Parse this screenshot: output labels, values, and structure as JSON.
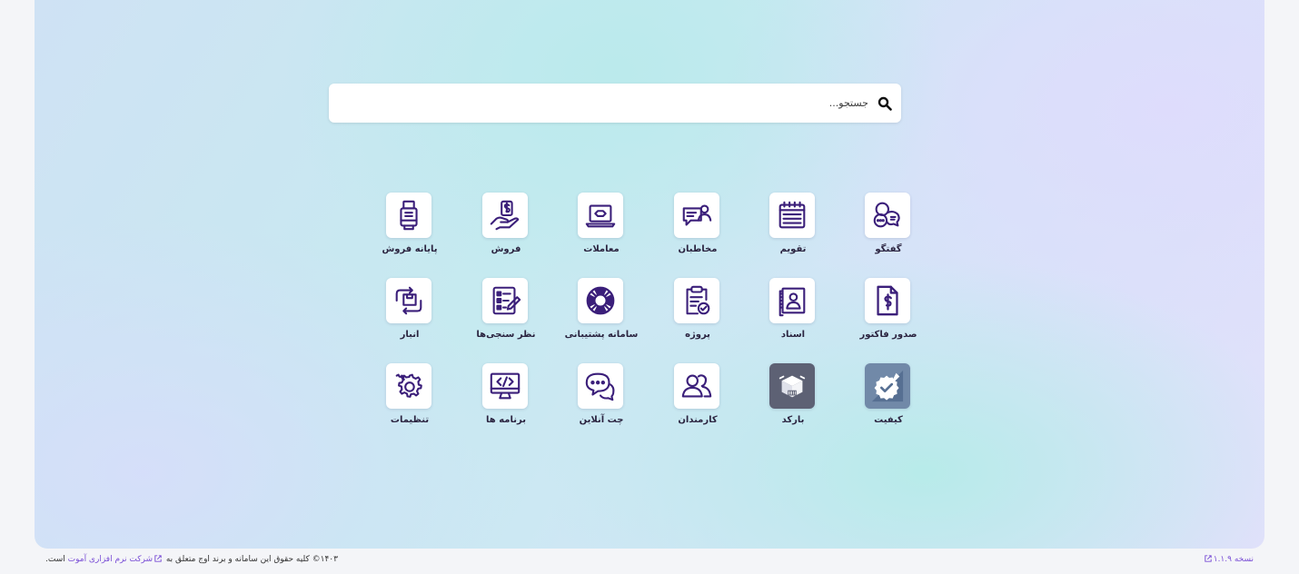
{
  "search": {
    "placeholder": "جستجو..."
  },
  "apps": [
    {
      "name": "app-chat",
      "label": "گفتگو",
      "icon": "chat-bubbles-icon"
    },
    {
      "name": "app-calendar",
      "label": "تقویم",
      "icon": "calendar-icon"
    },
    {
      "name": "app-contacts",
      "label": "مخاطبان",
      "icon": "contact-card-icon"
    },
    {
      "name": "app-deals",
      "label": "معاملات",
      "icon": "laptop-deal-icon"
    },
    {
      "name": "app-sales",
      "label": "فروش",
      "icon": "hand-money-icon"
    },
    {
      "name": "app-pos",
      "label": "پایانه فروش",
      "icon": "pos-terminal-icon"
    },
    {
      "name": "app-invoicing",
      "label": "صدور فاکتور",
      "icon": "invoice-dollar-icon"
    },
    {
      "name": "app-documents",
      "label": "اسناد",
      "icon": "documents-icon"
    },
    {
      "name": "app-project",
      "label": "پروژه",
      "icon": "clipboard-check-icon"
    },
    {
      "name": "app-helpdesk",
      "label": "سامانه پشتیبانی",
      "icon": "lifebuoy-icon"
    },
    {
      "name": "app-surveys",
      "label": "نظر سنجی‌ها",
      "icon": "survey-icon"
    },
    {
      "name": "app-inventory",
      "label": "انبار",
      "icon": "warehouse-box-icon"
    },
    {
      "name": "app-quality",
      "label": "کیفیت",
      "icon": "quality-badge-icon"
    },
    {
      "name": "app-barcode",
      "label": "بارکد",
      "icon": "barcode-box-icon"
    },
    {
      "name": "app-employees",
      "label": "کارمندان",
      "icon": "employees-icon"
    },
    {
      "name": "app-livechat",
      "label": "چت آنلاین",
      "icon": "live-chat-icon"
    },
    {
      "name": "app-apps",
      "label": "برنامه ها",
      "icon": "monitor-code-icon"
    },
    {
      "name": "app-settings",
      "label": "تنظیمات",
      "icon": "gears-icon"
    }
  ],
  "footer": {
    "copyright_prefix": "۱۴۰۳",
    "copyright_symbol": "©",
    "copyright_text": "کلیه حقوق این سامانه و برند اوج متعلق به",
    "company_link": "شرکت نرم افزاری آموت",
    "copyright_suffix": "است.",
    "version_label": "نسخه ۱.۱.۹"
  },
  "colors": {
    "icon": "#3b1f7a",
    "accent": "#7a4fd6"
  }
}
